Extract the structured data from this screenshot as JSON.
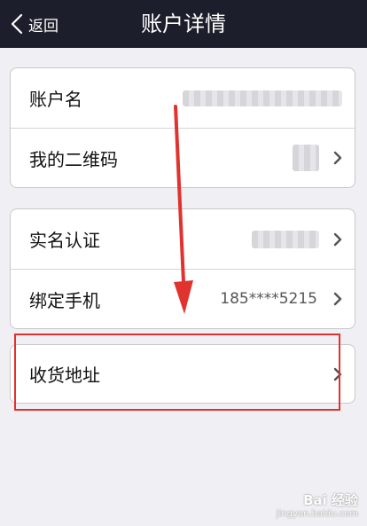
{
  "navbar": {
    "back_label": "返回",
    "title": "账户详情"
  },
  "group1": {
    "items": [
      {
        "label": "账户名"
      },
      {
        "label": "我的二维码"
      }
    ]
  },
  "group2": {
    "items": [
      {
        "label": "实名认证"
      },
      {
        "label": "绑定手机",
        "value": "185****5215"
      }
    ]
  },
  "group3": {
    "items": [
      {
        "label": "收货地址"
      }
    ]
  },
  "watermark": {
    "brand": "Bai 经验",
    "url": "jingyan.baidu.com"
  },
  "colors": {
    "navbar": "#1c1f2b",
    "background": "#efeff4",
    "annotation_red": "#e0322f"
  }
}
